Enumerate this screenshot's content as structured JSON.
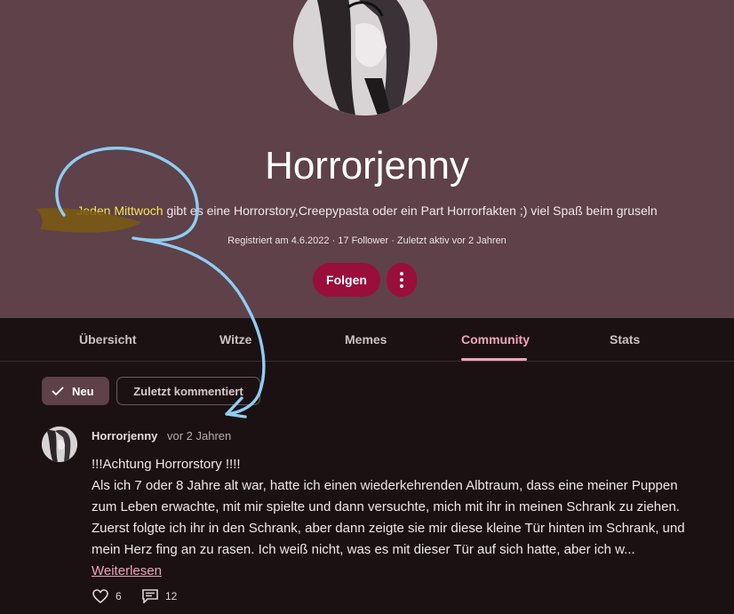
{
  "profile": {
    "name": "Horrorjenny",
    "bio_highlight": "Jeden Mittwoch",
    "bio_rest": " gibt es eine Horrorstory,Creepypasta oder ein Part Horrorfakten ;) viel Spaß beim gruseln",
    "meta": "Registriert am 4.6.2022 · 17 Follower · Zuletzt aktiv vor 2 Jahren",
    "follow_label": "Folgen"
  },
  "tabs": [
    {
      "label": "Übersicht"
    },
    {
      "label": "Witze"
    },
    {
      "label": "Memes"
    },
    {
      "label": "Community"
    },
    {
      "label": "Stats"
    }
  ],
  "filters": {
    "new_label": "Neu",
    "recent_label": "Zuletzt kommentiert"
  },
  "post": {
    "author": "Horrorjenny",
    "time": "vor 2 Jahren",
    "title": "!!!Achtung Horrorstory !!!!",
    "body": "Als ich 7 oder 8 Jahre alt war, hatte ich einen wiederkehrenden Albtraum, dass eine meiner Puppen zum Leben erwachte, mit mir spielte und dann versuchte, mich mit ihr in meinen Schrank zu ziehen. Zuerst folgte ich ihr in den Schrank, aber dann zeigte sie mir diese kleine Tür hinten im Schrank, und mein Herz fing an zu rasen. Ich weiß nicht, was es mit dieser Tür auf sich hatte, aber ich w... ",
    "read_more": "Weiterlesen",
    "likes": "6",
    "comments": "12"
  },
  "colors": {
    "accent": "#9a0e3c",
    "header_bg": "#5e4149",
    "active_tab": "#f3a2bd",
    "annotation": "#8fcdf2"
  }
}
